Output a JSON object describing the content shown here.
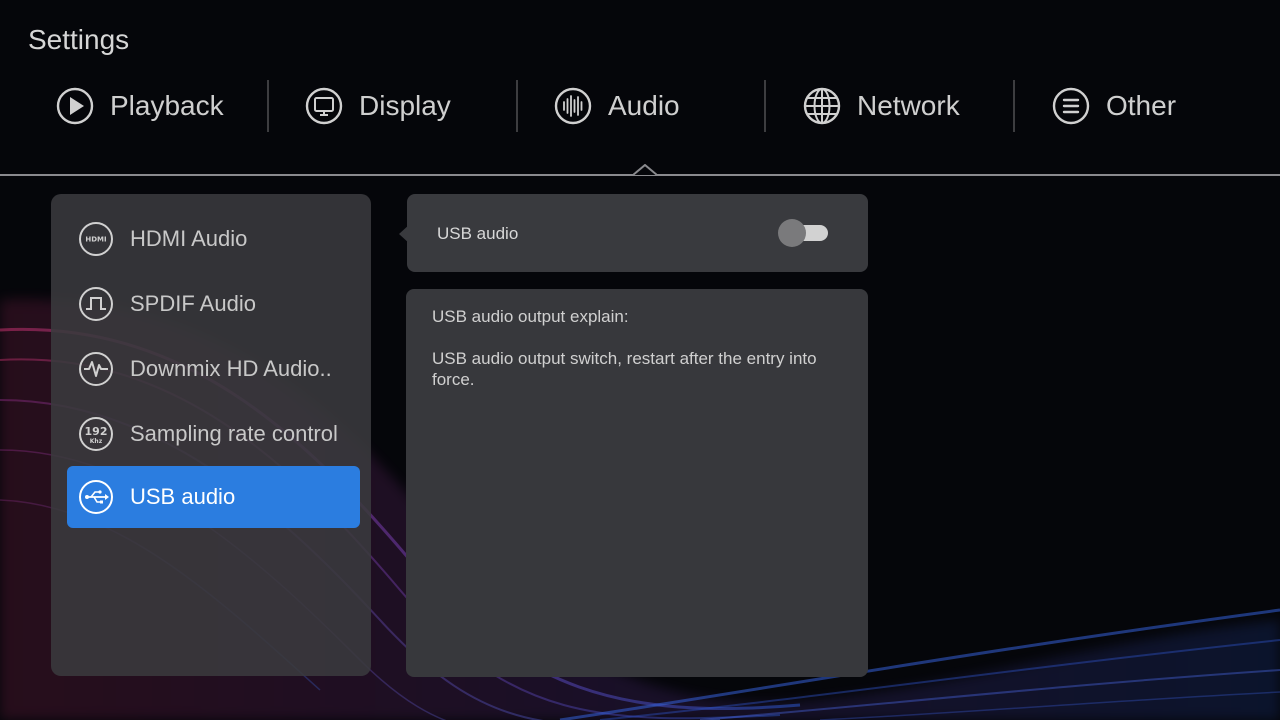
{
  "page": {
    "title": "Settings"
  },
  "tabs": [
    {
      "label": "Playback",
      "icon": "play-icon"
    },
    {
      "label": "Display",
      "icon": "monitor-icon"
    },
    {
      "label": "Audio",
      "icon": "audio-wave-icon"
    },
    {
      "label": "Network",
      "icon": "globe-icon"
    },
    {
      "label": "Other",
      "icon": "menu-list-icon"
    }
  ],
  "active_tab": "Audio",
  "menu": {
    "items": [
      {
        "label": "HDMI Audio",
        "icon": "hdmi-icon",
        "icon_text": "HDMI"
      },
      {
        "label": "SPDIF Audio",
        "icon": "spdif-pulse-icon"
      },
      {
        "label": "Downmix HD Audio..",
        "icon": "heartbeat-wave-icon"
      },
      {
        "label": "Sampling rate control",
        "icon": "sample-rate-icon",
        "icon_text": "192",
        "icon_subtext": "Khz"
      },
      {
        "label": "USB audio",
        "icon": "usb-icon"
      }
    ],
    "selected": "USB audio"
  },
  "setting": {
    "label": "USB audio",
    "enabled": false
  },
  "description": {
    "title": "USB audio output explain:",
    "body": "USB audio output switch, restart after the entry into force."
  },
  "colors": {
    "accent": "#2b7de0",
    "panel": "#3a3a3e",
    "background": "#05060a"
  }
}
